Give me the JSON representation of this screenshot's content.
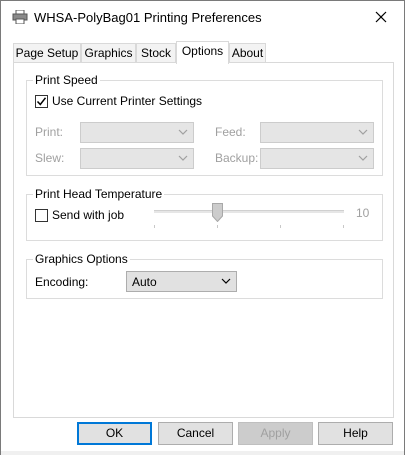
{
  "window": {
    "title": "WHSA-PolyBag01 Printing Preferences"
  },
  "tabs": [
    {
      "label": "Page Setup"
    },
    {
      "label": "Graphics"
    },
    {
      "label": "Stock"
    },
    {
      "label": "Options",
      "active": true
    },
    {
      "label": "About"
    }
  ],
  "print_speed": {
    "title": "Print Speed",
    "use_current_label": "Use Current Printer Settings",
    "use_current_checked": true,
    "print_label": "Print:",
    "feed_label": "Feed:",
    "slew_label": "Slew:",
    "backup_label": "Backup:"
  },
  "print_head": {
    "title": "Print Head Temperature",
    "send_with_job_label": "Send with job",
    "send_with_job_checked": false,
    "slider_value": "10"
  },
  "graphics_options": {
    "title": "Graphics Options",
    "encoding_label": "Encoding:",
    "encoding_value": "Auto"
  },
  "buttons": {
    "ok": "OK",
    "cancel": "Cancel",
    "apply": "Apply",
    "help": "Help"
  },
  "colors": {
    "accent": "#0078d7",
    "disabled_text": "#a0a0a0"
  }
}
